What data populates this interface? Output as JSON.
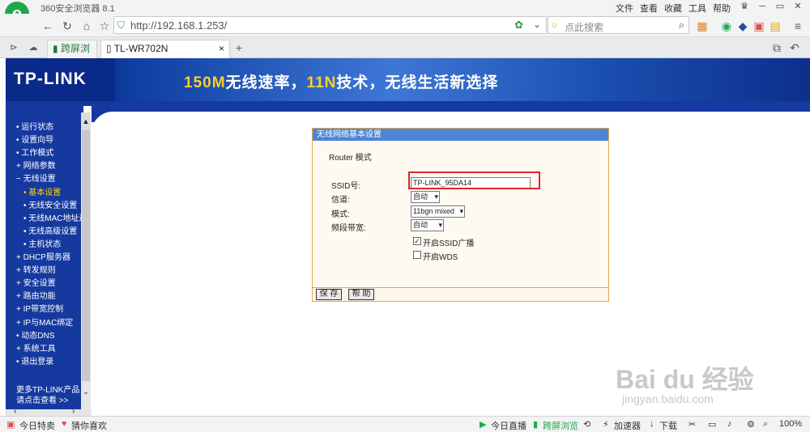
{
  "browser": {
    "app_title": "360安全浏览器 8.1",
    "menu": [
      "文件",
      "查看",
      "收藏",
      "工具",
      "帮助"
    ],
    "url": "http://192.168.1.253/",
    "search_placeholder": "点此搜索",
    "tabs": [
      "跨屏浏览",
      "TL-WR702N"
    ],
    "status_left": [
      "今日特卖",
      "猜你喜欢"
    ],
    "status_right": [
      "今日直播",
      "跨屏浏览",
      "加速器",
      "下载",
      "100%"
    ]
  },
  "banner": {
    "brand": "TP-LINK",
    "slogan_parts": [
      "150M",
      "无线速率，",
      "11N",
      "技术，无线生活新选择"
    ]
  },
  "sidebar": {
    "items": [
      {
        "label": "• 运行状态",
        "level": 0
      },
      {
        "label": "• 设置向导",
        "level": 0
      },
      {
        "label": "• 工作模式",
        "level": 0
      },
      {
        "label": "+ 网络参数",
        "level": 0
      },
      {
        "label": "− 无线设置",
        "level": 0
      },
      {
        "label": "• 基本设置",
        "level": 1,
        "active": true
      },
      {
        "label": "• 无线安全设置",
        "level": 1
      },
      {
        "label": "• 无线MAC地址过滤",
        "level": 1
      },
      {
        "label": "• 无线高级设置",
        "level": 1
      },
      {
        "label": "• 主机状态",
        "level": 1
      },
      {
        "label": "+ DHCP服务器",
        "level": 0
      },
      {
        "label": "+ 转发规则",
        "level": 0
      },
      {
        "label": "+ 安全设置",
        "level": 0
      },
      {
        "label": "+ 路由功能",
        "level": 0
      },
      {
        "label": "+ IP带宽控制",
        "level": 0
      },
      {
        "label": "+ IP与MAC绑定",
        "level": 0
      },
      {
        "label": "• 动态DNS",
        "level": 0
      },
      {
        "label": "+ 系统工具",
        "level": 0
      },
      {
        "label": "• 退出登录",
        "level": 0
      }
    ],
    "more_line1": "更多TP-LINK产品，",
    "more_line2": "请点击查看 >>"
  },
  "form": {
    "title": "无线网络基本设置",
    "mode_text": "Router 模式",
    "ssid_label": "SSID号:",
    "ssid_value": "TP-LINK_95DA14",
    "channel_label": "信道:",
    "channel_value": "自动",
    "mode_label": "模式:",
    "mode_value": "11bgn mixed",
    "bandwidth_label": "频段带宽:",
    "bandwidth_value": "自动",
    "ssid_broadcast_label": "开启SSID广播",
    "ssid_broadcast_checked": true,
    "wds_label": "开启WDS",
    "wds_checked": false,
    "save_label": "保 存",
    "help_label": "帮 助"
  },
  "watermark": {
    "line1": "Bai du 经验",
    "line2": "jingyan.baidu.com"
  }
}
